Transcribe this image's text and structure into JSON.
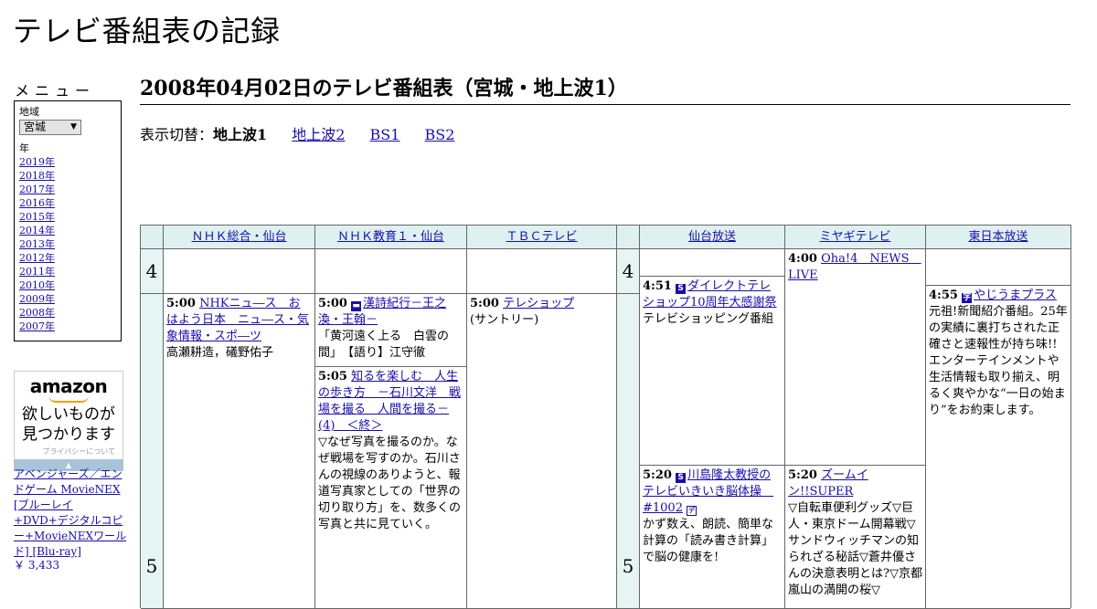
{
  "site": {
    "title": "テレビ番組表の記録"
  },
  "menu": {
    "title": "メニュー",
    "region_label": "地域",
    "region_value": "宮城",
    "year_label": "年",
    "years": [
      "2019年",
      "2018年",
      "2017年",
      "2016年",
      "2015年",
      "2014年",
      "2013年",
      "2012年",
      "2011年",
      "2010年",
      "2009年",
      "2008年",
      "2007年"
    ]
  },
  "ad": {
    "logo": "amazon",
    "text1": "欲しいものが",
    "text2": "見つかります",
    "privacy": "プライバシーについて",
    "product": "アベンジャーズ／エンドゲーム MovieNEX [ブルーレイ+DVD+デジタルコピー+MovieNEXワールド] [Blu-ray]",
    "price": "￥ 3,433"
  },
  "page": {
    "heading": "2008年04月02日のテレビ番組表（宮城・地上波1）",
    "switch_label": "表示切替：",
    "switch_current": "地上波1",
    "switch_links": [
      "地上波2",
      "BS1",
      "BS2"
    ]
  },
  "grid": {
    "channels": [
      "ＮＨＫ総合・仙台",
      "ＮＨＫ教育１・仙台",
      "ＴＢＣテレビ",
      "仙台放送",
      "ミヤギテレビ",
      "東日本放送"
    ],
    "hours": [
      "4",
      "5"
    ],
    "programs": {
      "nhk_g_500": {
        "time": "5:00",
        "title": "NHKニュ―ス　おはよう日本　ニュ―ス・気象情報・スポ―ツ",
        "desc": "高瀬耕造，礒野佑子"
      },
      "nhk_e_500": {
        "time": "5:00",
        "title": "漢詩紀行－王之渙・王翰－",
        "desc": "「黄河遠く上る　白雲の間」　【語り】江守徹"
      },
      "nhk_e_505": {
        "time": "5:05",
        "title": "知るを楽しむ　人生の歩き方　－石川文洋　戦場を撮る　人間を撮る－(4)　＜終＞",
        "desc": "▽なぜ写真を撮るのか。なぜ戦場を写すのか。石川さんの視線のありようと、報道写真家としての「世界の切り取り方」を、数多くの写真と共に見ていく。"
      },
      "tbc_500": {
        "time": "5:00",
        "title": "テレショップ",
        "desc": "(サントリー)"
      },
      "ox_451": {
        "time": "4:51",
        "title": "ダイレクトテレショップ10周年大感謝祭",
        "desc": "テレビショッピング番組"
      },
      "ox_520": {
        "time": "5:20",
        "title": "川島隆太教授のテレビいきいき脳体操　#1002",
        "desc": "かず数え、朗読、簡単な計算の「読み書き計算」で脳の健康を!"
      },
      "mmt_400": {
        "time": "4:00",
        "title": "Oha!4　NEWS　LIVE",
        "desc": ""
      },
      "mmt_520": {
        "time": "5:20",
        "title": "ズームイン!!SUPER",
        "desc": "▽自転車便利グッズ▽巨人・東京ドーム開幕戦▽サンドウィッチマンの知られざる秘話▽蒼井優さんの決意表明とは?▽京都嵐山の満開の桜▽"
      },
      "khb_455": {
        "time": "4:55",
        "title": "やじうまプラス",
        "desc": "元祖!新聞紹介番組。25年の実績に裏打ちされた正確さと速報性が持ち味!!エンターテインメントや生活情報も取り揃え、明るく爽やかな“一日の始まり”をお約束します。"
      }
    }
  }
}
